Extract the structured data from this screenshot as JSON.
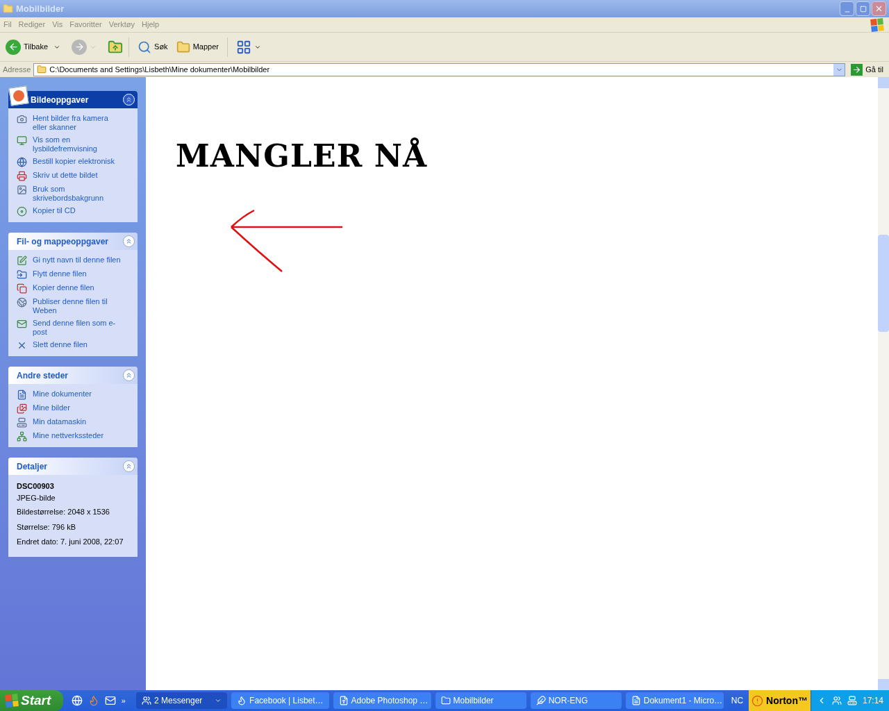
{
  "window": {
    "title": "Mobilbilder"
  },
  "menu": [
    "Fil",
    "Rediger",
    "Vis",
    "Favoritter",
    "Verktøy",
    "Hjelp"
  ],
  "toolbar": {
    "back": "Tilbake",
    "search": "Søk",
    "folders": "Mapper"
  },
  "address": {
    "label": "Adresse",
    "value": "C:\\Documents and Settings\\Lisbeth\\Mine dokumenter\\Mobilbilder",
    "go": "Gå til"
  },
  "sidebar": [
    {
      "kind": "special",
      "title": "Bildeoppgaver",
      "items": [
        "Hent bilder fra kamera eller skanner",
        "Vis som en lysbildefremvisning",
        "Bestill kopier elektronisk",
        "Skriv ut dette bildet",
        "Bruk som skrivebordsbakgrunn",
        "Kopier til CD"
      ]
    },
    {
      "kind": "normal",
      "title": "Fil- og mappeoppgaver",
      "items": [
        "Gi nytt navn til denne filen",
        "Flytt denne filen",
        "Kopier denne filen",
        "Publiser denne filen til Weben",
        "Send denne filen som e-post",
        "Slett denne filen"
      ]
    },
    {
      "kind": "normal",
      "title": "Andre steder",
      "items": [
        "Mine dokumenter",
        "Mine bilder",
        "Min datamaskin",
        "Mine nettverkssteder"
      ]
    },
    {
      "kind": "details",
      "title": "Detaljer",
      "name": "DSC00903",
      "type": "JPEG-bilde",
      "lines": [
        "Bildestørrelse: 2048 x 1536",
        "Størrelse: 796 kB",
        "Endret dato: 7. juni 2008, 22:07"
      ]
    }
  ],
  "preview": {
    "text": "MANGLER NÅ"
  },
  "taskbar": {
    "start": "Start",
    "quick_more": "»",
    "tasks": [
      "2 Messenger",
      "Facebook | Lisbet…",
      "Adobe Photoshop …",
      "Mobilbilder",
      "NOR-ENG",
      "Dokument1 - Micro…"
    ],
    "tray_text": "NC",
    "norton": "Norton™",
    "clock": "17:14"
  }
}
